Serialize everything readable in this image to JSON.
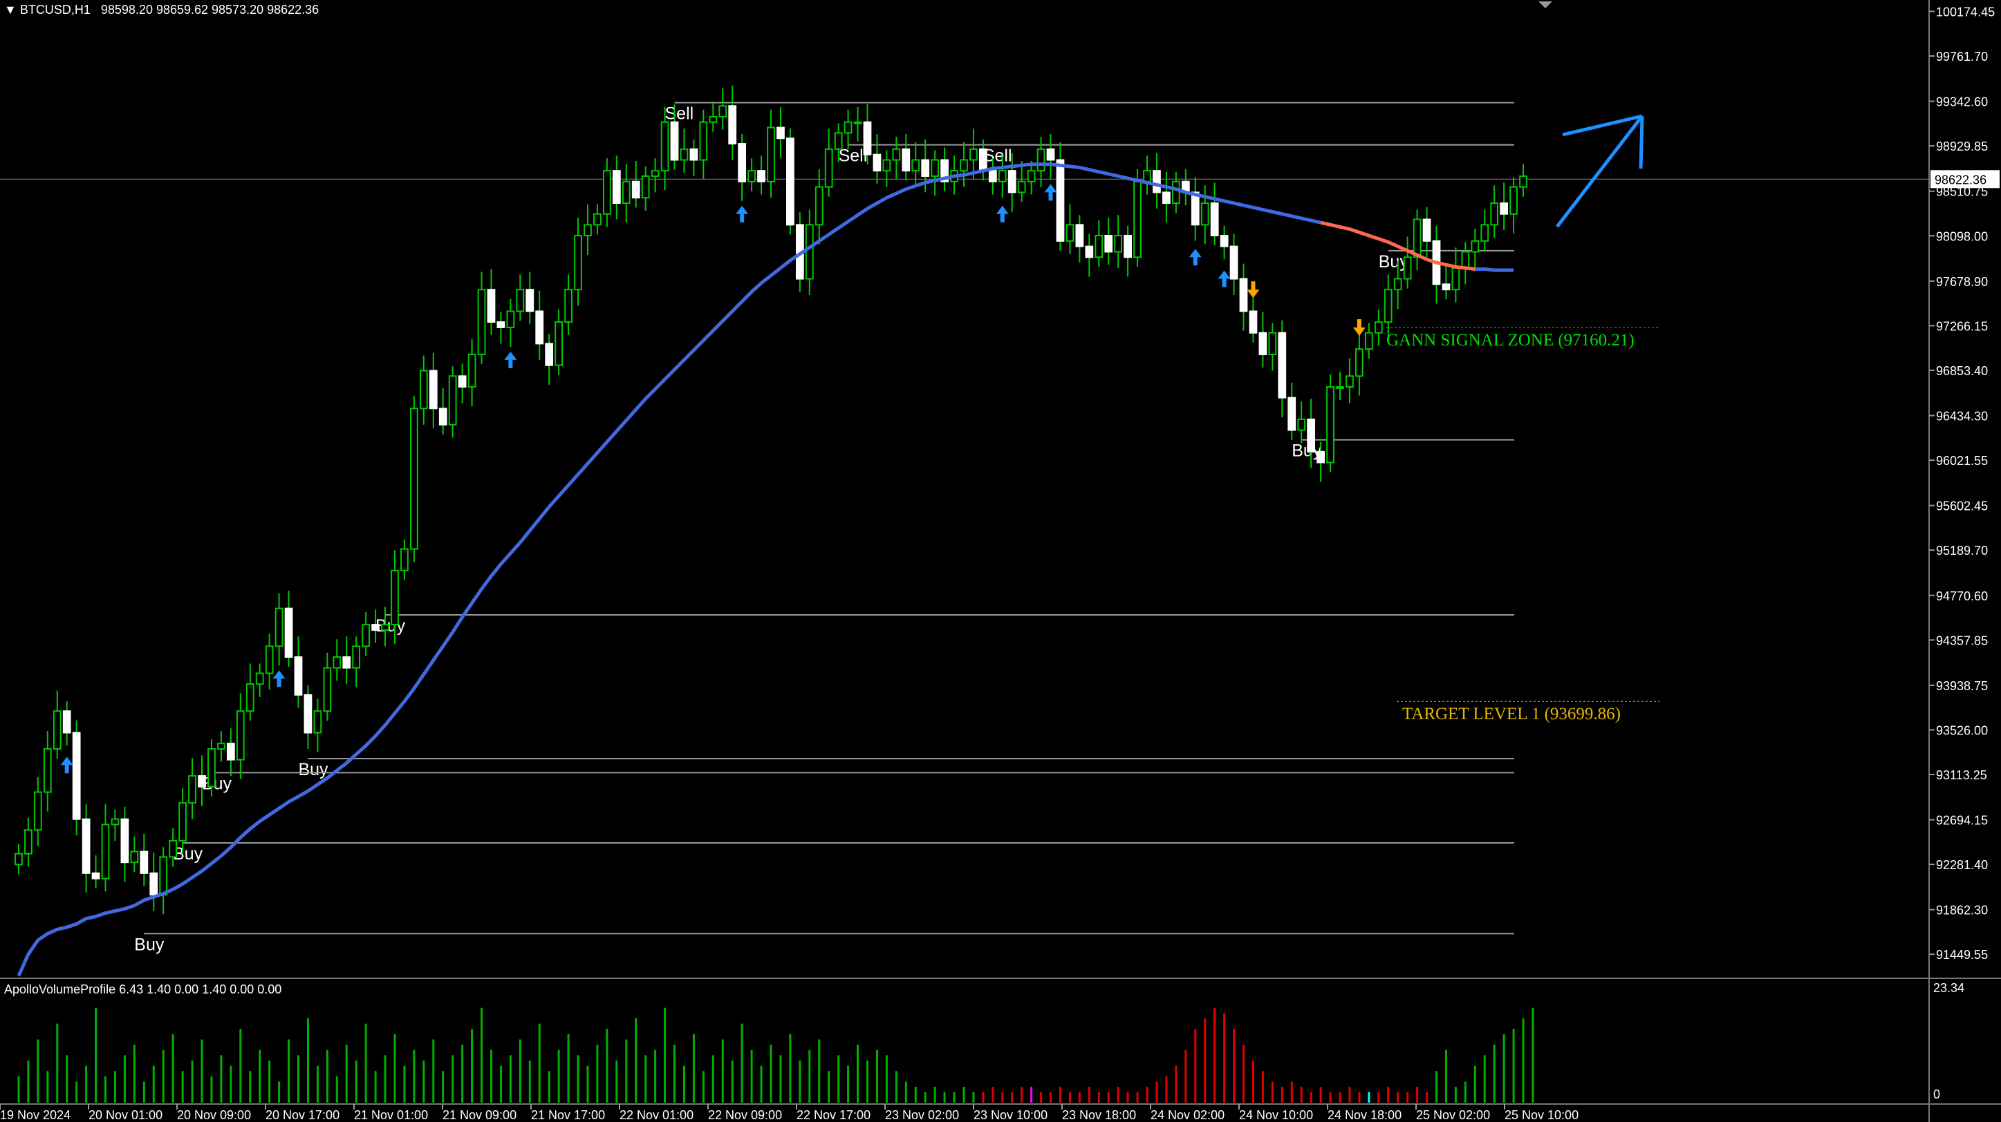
{
  "header": {
    "symbol": "BTCUSD,H1",
    "ohlc": "98598.20 98659.62 98573.20 98622.36"
  },
  "indicator": {
    "label": "ApolloVolumeProfile 6.43 1.40 0.00 1.40 0.00 0.00",
    "scale_top": "23.34",
    "scale_bottom": "0"
  },
  "colors": {
    "background": "#000000",
    "candle_up_body": "#000000",
    "candle_down_body": "#ffffff",
    "wick": "#00c800",
    "ma_line": "#4169e1",
    "ma_recent": "#ff6a4d",
    "signal_arrow": "#1e90ff",
    "sell_arrow": "#ffa500",
    "level_line": "#9a9a9a",
    "gann_text": "#00e000",
    "target_text": "#e6b800",
    "volume_normal": "#00b000",
    "volume_high": "#e00000",
    "volume_magenta": "#ff00ff",
    "volume_cyan": "#00ffff"
  },
  "chart_data": {
    "type": "candlestick",
    "symbol": "BTCUSD",
    "timeframe": "H1",
    "ylim": [
      91240,
      100280
    ],
    "y_ticks": [
      "100174.45",
      "99761.70",
      "99342.60",
      "98929.85",
      "98510.75",
      "98098.00",
      "97678.90",
      "97266.15",
      "96853.40",
      "96434.30",
      "96021.55",
      "95602.45",
      "95189.70",
      "94770.60",
      "94357.85",
      "93938.75",
      "93526.00",
      "93113.25",
      "92694.15",
      "92281.40",
      "91862.30",
      "91449.55"
    ],
    "current_price": "98622.36",
    "x_ticks": [
      "19 Nov 2024",
      "20 Nov 01:00",
      "20 Nov 09:00",
      "20 Nov 17:00",
      "21 Nov 01:00",
      "21 Nov 09:00",
      "21 Nov 17:00",
      "22 Nov 01:00",
      "22 Nov 09:00",
      "22 Nov 17:00",
      "23 Nov 02:00",
      "23 Nov 10:00",
      "23 Nov 18:00",
      "24 Nov 02:00",
      "24 Nov 10:00",
      "24 Nov 18:00",
      "25 Nov 02:00",
      "25 Nov 10:00"
    ],
    "closes": [
      92380,
      92600,
      92950,
      93350,
      93700,
      93500,
      92700,
      92200,
      92150,
      92650,
      92700,
      92300,
      92400,
      92200,
      92000,
      92350,
      92500,
      92850,
      93100,
      93000,
      93350,
      93400,
      93250,
      93700,
      93950,
      94050,
      94300,
      94650,
      94200,
      93850,
      93500,
      93700,
      94100,
      94200,
      94100,
      94300,
      94500,
      94450,
      94500,
      95000,
      95200,
      96500,
      96850,
      96500,
      96350,
      96800,
      96700,
      97000,
      97600,
      97300,
      97250,
      97400,
      97600,
      97400,
      97100,
      96900,
      97300,
      97600,
      98100,
      98200,
      98300,
      98700,
      98400,
      98600,
      98450,
      98650,
      98700,
      99150,
      98800,
      98900,
      98800,
      99150,
      99200,
      99300,
      98950,
      98600,
      98700,
      98600,
      99100,
      99000,
      98200,
      97700,
      98200,
      98550,
      98900,
      99050,
      99150,
      99150,
      98850,
      98700,
      98800,
      98900,
      98700,
      98800,
      98650,
      98800,
      98600,
      98700,
      98800,
      98900,
      98700,
      98600,
      98700,
      98500,
      98600,
      98700,
      98900,
      98800,
      98050,
      98200,
      98000,
      97900,
      98100,
      97950,
      98100,
      97900,
      98600,
      98700,
      98500,
      98400,
      98600,
      98500,
      98200,
      98400,
      98100,
      98000,
      97700,
      97400,
      97200,
      97000,
      97200,
      96600,
      96300,
      96400,
      96100,
      96000,
      96700,
      96700,
      96800,
      97050,
      97200,
      97300,
      97600,
      97700,
      97900,
      98250,
      98050,
      97650,
      97600,
      97800,
      97950,
      98050,
      98200,
      98400,
      98300,
      98550,
      98650
    ],
    "moving_average": [
      91250,
      91450,
      91580,
      91640,
      91680,
      91700,
      91730,
      91780,
      91800,
      91830,
      91850,
      91870,
      91900,
      91950,
      91980,
      92010,
      92050,
      92100,
      92160,
      92220,
      92290,
      92360,
      92440,
      92530,
      92610,
      92680,
      92740,
      92800,
      92860,
      92910,
      92960,
      93020,
      93080,
      93150,
      93220,
      93300,
      93380,
      93470,
      93570,
      93680,
      93790,
      93910,
      94040,
      94170,
      94300,
      94430,
      94570,
      94700,
      94830,
      94950,
      95060,
      95160,
      95260,
      95370,
      95480,
      95590,
      95690,
      95790,
      95890,
      95990,
      96090,
      96190,
      96290,
      96390,
      96490,
      96590,
      96680,
      96770,
      96860,
      96950,
      97040,
      97130,
      97220,
      97310,
      97400,
      97490,
      97580,
      97660,
      97730,
      97800,
      97870,
      97930,
      97990,
      98050,
      98110,
      98170,
      98230,
      98290,
      98350,
      98400,
      98450,
      98490,
      98530,
      98560,
      98590,
      98610,
      98630,
      98650,
      98660,
      98680,
      98700,
      98720,
      98730,
      98740,
      98750,
      98760,
      98760,
      98760,
      98750,
      98740,
      98730,
      98710,
      98690,
      98670,
      98650,
      98630,
      98610,
      98590,
      98570,
      98550,
      98530,
      98500,
      98480,
      98460,
      98440,
      98420,
      98400,
      98380,
      98360,
      98340,
      98320,
      98300,
      98280,
      98260,
      98240,
      98220,
      98200,
      98180,
      98160,
      98130,
      98100,
      98070,
      98040,
      98000,
      97960,
      97920,
      97880,
      97850,
      97830,
      97810,
      97800,
      97790,
      97790,
      97780,
      97780,
      97780
    ],
    "signals": [
      {
        "label": "Buy",
        "price": 94590,
        "start": 38
      },
      {
        "label": "Buy",
        "price": 93260,
        "start": 30
      },
      {
        "label": "Buy",
        "price": 93130,
        "start": 20
      },
      {
        "label": "Buy",
        "price": 92480,
        "start": 17
      },
      {
        "label": "Buy",
        "price": 91640,
        "start": 13
      },
      {
        "label": "Sell",
        "price": 99330,
        "start": 68
      },
      {
        "label": "Sell",
        "price": 98940,
        "start": 86
      },
      {
        "label": "Sell",
        "price": 98940,
        "start": 101
      },
      {
        "label": "Buy",
        "price": 96210,
        "start": 133
      },
      {
        "label": "Buy",
        "price": 97960,
        "start": 142
      }
    ],
    "up_arrows": [
      5,
      27,
      51,
      75,
      102,
      107,
      122,
      125
    ],
    "down_arrows": [
      128,
      139
    ],
    "annotations": [
      {
        "label": "GANN SIGNAL ZONE (97160.21)",
        "price": 97160.21
      },
      {
        "label": "TARGET LEVEL 1 (93699.86)",
        "price": 93699.86
      }
    ],
    "volume": [
      5,
      8,
      12,
      6,
      15,
      9,
      4,
      7,
      18,
      5,
      6,
      9,
      11,
      4,
      7,
      10,
      13,
      6,
      8,
      12,
      5,
      9,
      7,
      14,
      6,
      10,
      8,
      4,
      12,
      9,
      16,
      7,
      10,
      5,
      11,
      8,
      15,
      6,
      9,
      13,
      7,
      10,
      8,
      12,
      6,
      9,
      11,
      14,
      18,
      10,
      7,
      9,
      12,
      8,
      15,
      6,
      10,
      13,
      9,
      7,
      11,
      14,
      8,
      12,
      16,
      9,
      10,
      18,
      11,
      7,
      13,
      6,
      9,
      12,
      8,
      15,
      10,
      7,
      11,
      9,
      13,
      8,
      10,
      12,
      6,
      9,
      7,
      11,
      8,
      10,
      9,
      6,
      4,
      3,
      2,
      3,
      2,
      2,
      3,
      2,
      2,
      3,
      2,
      2,
      3,
      3,
      2,
      2,
      3,
      2,
      2,
      3,
      2,
      2,
      3,
      2,
      2,
      3,
      4,
      5,
      7,
      10,
      14,
      16,
      18,
      17,
      14,
      11,
      8,
      6,
      4,
      3,
      4,
      3,
      2,
      3,
      2,
      2,
      3,
      2,
      2,
      2,
      3,
      2,
      2,
      3,
      2,
      6,
      10,
      3,
      4,
      7,
      9,
      11,
      13,
      14,
      16,
      18
    ]
  }
}
